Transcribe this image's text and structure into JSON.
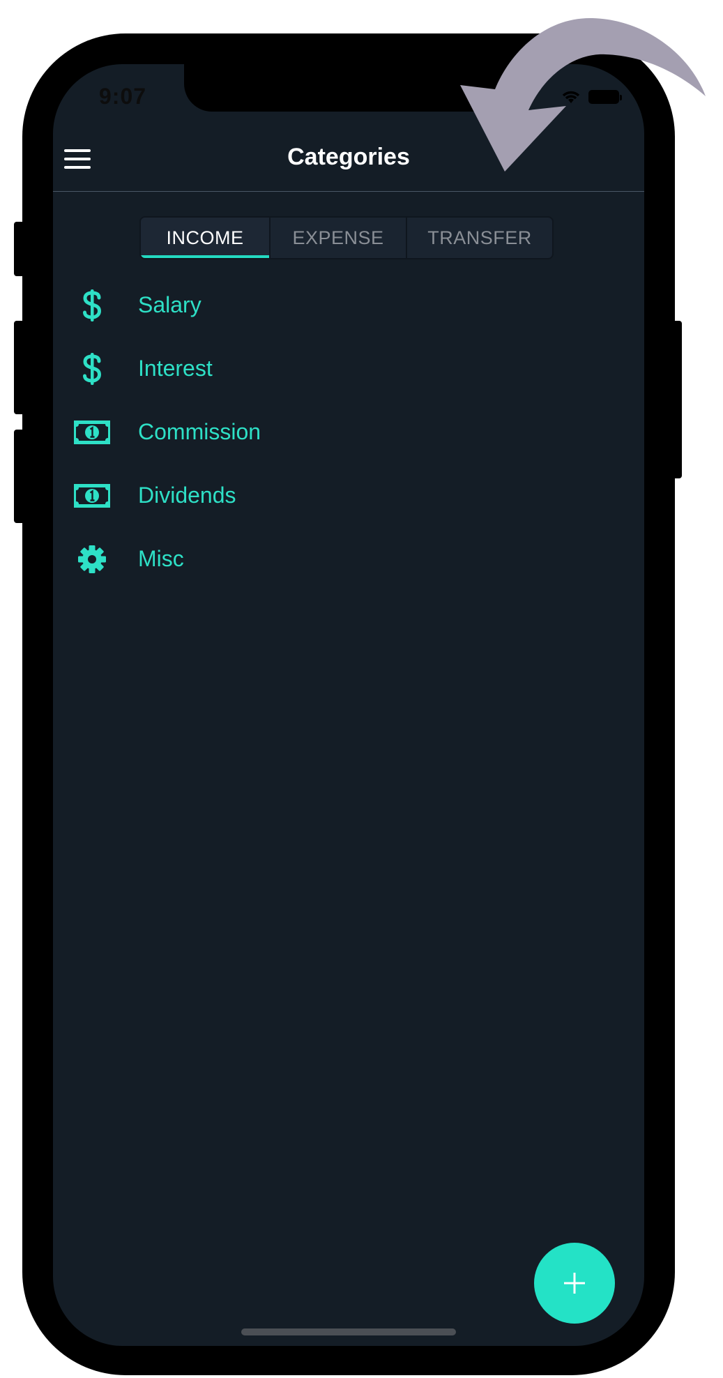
{
  "status_bar": {
    "time": "9:07"
  },
  "navbar": {
    "title": "Categories",
    "menu_icon": "hamburger-menu-icon"
  },
  "segments": [
    {
      "label": "INCOME",
      "active": true
    },
    {
      "label": "EXPENSE",
      "active": false
    },
    {
      "label": "TRANSFER",
      "active": false
    }
  ],
  "categories": [
    {
      "label": "Salary",
      "icon": "dollar-sign-icon"
    },
    {
      "label": "Interest",
      "icon": "dollar-sign-icon"
    },
    {
      "label": "Commission",
      "icon": "money-bill-icon"
    },
    {
      "label": "Dividends",
      "icon": "money-bill-icon"
    },
    {
      "label": "Misc",
      "icon": "gear-icon"
    }
  ],
  "fab": {
    "icon": "plus-icon"
  },
  "colors": {
    "accent": "#24e2c6",
    "background": "#141d26",
    "annotation_arrow": "#a49fb1"
  }
}
